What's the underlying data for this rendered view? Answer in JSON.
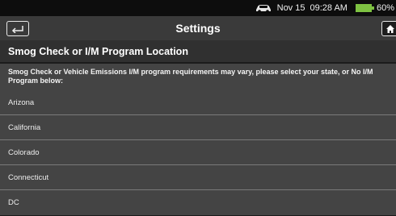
{
  "status_bar": {
    "icons": [
      "car-icon",
      "battery-icon"
    ],
    "date": "Nov 15",
    "time": "09:28 AM",
    "battery_percent": "60%",
    "battery_color": "#7ec242"
  },
  "title_bar": {
    "title": "Settings",
    "back_icon": "back-arrow-icon",
    "home_icon": "home-icon"
  },
  "section": {
    "header": "Smog Check or I/M Program Location",
    "instruction": "Smog Check or Vehicle Emissions I/M program requirements may vary, please select your state, or No I/M Program below:"
  },
  "locations": [
    {
      "label": "Arizona"
    },
    {
      "label": "California"
    },
    {
      "label": "Colorado"
    },
    {
      "label": "Connecticut"
    },
    {
      "label": "DC"
    }
  ]
}
